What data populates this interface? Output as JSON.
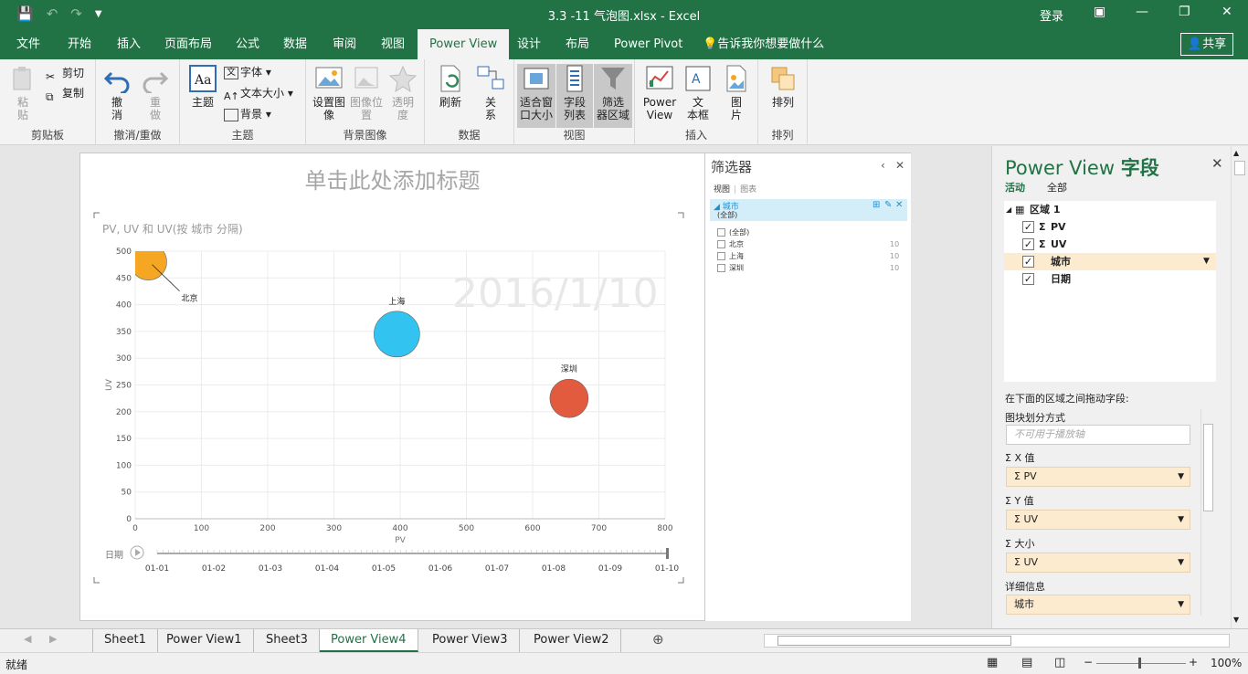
{
  "window": {
    "title": "3.3 -11 气泡图.xlsx  -  Excel",
    "login": "登录"
  },
  "tabs": [
    "文件",
    "开始",
    "插入",
    "页面布局",
    "公式",
    "数据",
    "审阅",
    "视图",
    "Power View",
    "设计",
    "布局",
    "Power Pivot",
    "告诉我你想要做什么"
  ],
  "share_label": "共享",
  "ribbon": {
    "clipboard": {
      "paste": "粘\n贴",
      "cut": "剪切",
      "copy": "复制",
      "group": "剪贴板"
    },
    "undo": {
      "undo": "撤\n消",
      "redo": "重\n做",
      "group": "撤消/重做"
    },
    "theme": {
      "theme": "主题",
      "font": "字体",
      "textsize": "文本大小",
      "background": "背景",
      "group": "主题"
    },
    "bgimage": {
      "set": "设置图\n像",
      "pos": "图像位\n置",
      "trans": "透明\n度",
      "group": "背景图像"
    },
    "data": {
      "refresh": "刷新",
      "relations": "关\n系",
      "group": "数据"
    },
    "view": {
      "fit": "适合窗\n口大小",
      "fieldlist": "字段\n列表",
      "filter": "筛选\n器区域",
      "group": "视图"
    },
    "insert": {
      "pv": "Power\nView",
      "textbox": "文\n本框",
      "picture": "图\n片",
      "group": "插入"
    },
    "arrange": {
      "arrange": "排列",
      "group": "排列"
    }
  },
  "view": {
    "title_placeholder": "单击此处添加标题"
  },
  "chart_data": {
    "type": "scatter",
    "title": "PV, UV 和 UV(按 城市 分隔)",
    "xlabel": "PV",
    "ylabel": "UV",
    "xlim": [
      0,
      800
    ],
    "ylim": [
      0,
      500
    ],
    "xticks": [
      0,
      100,
      200,
      300,
      400,
      500,
      600,
      700,
      800
    ],
    "yticks": [
      0,
      50,
      100,
      150,
      200,
      250,
      300,
      350,
      400,
      450,
      500
    ],
    "watermark": "2016/1/10",
    "points": [
      {
        "label": "北京",
        "x": 20,
        "y": 480,
        "size": 40,
        "color": "#f5a623"
      },
      {
        "label": "上海",
        "x": 395,
        "y": 345,
        "size": 50,
        "color": "#33c3f0"
      },
      {
        "label": "深圳",
        "x": 655,
        "y": 225,
        "size": 42,
        "color": "#e35b3f"
      }
    ],
    "play_axis": {
      "label": "日期",
      "ticks": [
        "01-01",
        "01-02",
        "01-03",
        "01-04",
        "01-05",
        "01-06",
        "01-07",
        "01-08",
        "01-09",
        "01-10"
      ]
    }
  },
  "filter_pane": {
    "title": "筛选器",
    "tab_view": "视图",
    "tab_chart": "图表",
    "field": "城市",
    "field_all": "(全部)",
    "items": [
      {
        "label": "(全部)",
        "count": ""
      },
      {
        "label": "北京",
        "count": "10"
      },
      {
        "label": "上海",
        "count": "10"
      },
      {
        "label": "深圳",
        "count": "10"
      }
    ]
  },
  "fields_pane": {
    "title_a": "Power View",
    "title_b": "字段",
    "tab_active": "活动",
    "tab_all": "全部",
    "table": "区域 1",
    "fields": [
      "PV",
      "UV",
      "城市",
      "日期"
    ],
    "drag_hint": "在下面的区域之间拖动字段:",
    "tile_by": "图块划分方式",
    "tile_placeholder": "不可用于播放轴",
    "x_label": "Σ X 值",
    "x_value": "Σ PV",
    "y_label": "Σ Y 值",
    "y_value": "Σ UV",
    "size_label": "Σ 大小",
    "size_value": "Σ UV",
    "detail_label": "详细信息",
    "detail_value": "城市"
  },
  "sheets": [
    "Sheet1",
    "Power View1",
    "Sheet3",
    "Power View4",
    "Power View3",
    "Power View2"
  ],
  "active_sheet": "Power View4",
  "status": {
    "ready": "就绪",
    "zoom": "100%"
  }
}
